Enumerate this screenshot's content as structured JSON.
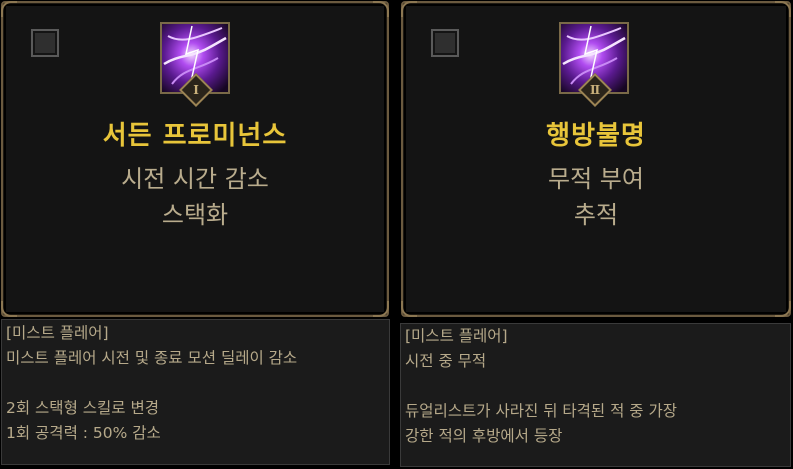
{
  "cards": [
    {
      "title": "서든 프로미넌스",
      "lines": [
        "시전 시간 감소",
        "스택화"
      ],
      "badge": "Ⅰ",
      "icon": "purple-lightning-skill-icon",
      "checked": false
    },
    {
      "title": "행방불명",
      "lines": [
        "무적 부여",
        "추적"
      ],
      "badge": "Ⅱ",
      "icon": "purple-lightning-skill-icon",
      "checked": false
    }
  ],
  "descriptions": [
    {
      "header": "[미스트 플레어]",
      "lines": [
        "미스트 플레어 시전 및 종료 모션 딜레이 감소",
        "",
        "2회 스택형 스킬로 변경",
        "1회 공격력 : 50% 감소"
      ]
    },
    {
      "header": "[미스트 플레어]",
      "lines": [
        "시전 중 무적",
        "",
        "듀얼리스트가 사라진 뒤 타격된 적 중 가장",
        "강한 적의 후방에서 등장"
      ]
    }
  ],
  "colors": {
    "title": "#e8c53a",
    "subtitle": "#b9ac8d",
    "border": "#6b5a3f",
    "desc_text": "#b6a98a"
  }
}
